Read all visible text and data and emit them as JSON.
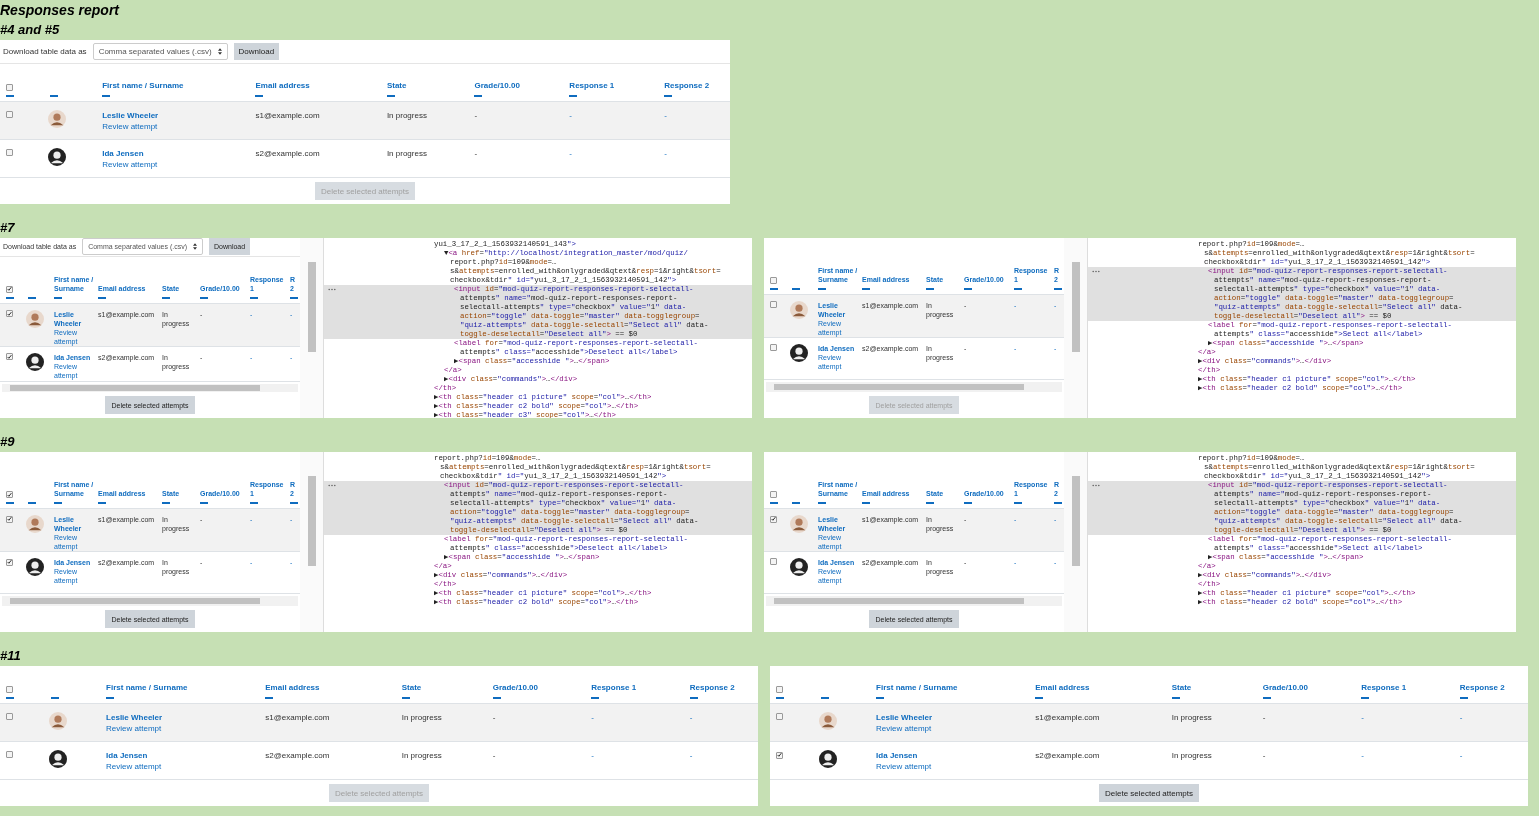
{
  "title": "Responses report",
  "sections": [
    {
      "heading": "#4 and #5",
      "panels": [
        {
          "kind": "report",
          "report": {
            "download": {
              "label": "Download table data as",
              "format": "Comma separated values (.csv)",
              "button": "Download"
            },
            "select_all_checked": false,
            "columns": [
              "First name / Surname",
              "Email address",
              "State",
              "Grade/10.00",
              "Response 1",
              "Response 2"
            ],
            "rows": [
              {
                "checked": false,
                "name": "Leslie Wheeler",
                "link": "Review attempt",
                "email": "s1@example.com",
                "state": "In progress",
                "grade": "-",
                "response_1": "-",
                "response_2": "-"
              },
              {
                "checked": false,
                "name": "Ida Jensen",
                "link": "Review attempt",
                "email": "s2@example.com",
                "state": "In progress",
                "grade": "-",
                "response_1": "-",
                "response_2": "-"
              }
            ],
            "delete_button": {
              "label": "Delete selected attempts",
              "disabled": true
            }
          }
        }
      ]
    },
    {
      "heading": "#7",
      "panels": [
        {
          "kind": "composite",
          "report": {
            "download": {
              "label": "Download table data as",
              "format": "Comma separated values (.csv)",
              "button": "Download"
            },
            "select_all_checked": true,
            "columns": [
              "First name / Surname",
              "Email address",
              "State",
              "Grade/10.00",
              "Response 1",
              "R 2"
            ],
            "rows": [
              {
                "checked": true,
                "name": "Leslie Wheeler",
                "link": "Review attempt",
                "email": "s1@example.com",
                "state": "In progress",
                "grade": "-",
                "response_1": "-",
                "response_2": "-"
              },
              {
                "checked": true,
                "name": "Ida Jensen",
                "link": "Review attempt",
                "email": "s2@example.com",
                "state": "In progress",
                "grade": "-",
                "response_1": "-",
                "response_2": "-"
              }
            ],
            "delete_button": {
              "label": "Delete selected attempts",
              "disabled": false
            }
          },
          "dom": [
            {
              "lines": [
                "yui_3_17_2_1_1563932140591_143\">"
              ],
              "selected": false,
              "close": "</th>",
              "children": [
                {
                  "lines": [
                    "▼<a href=\"http://localhost/integration_master/mod/quiz/",
                    "report.php?id=109&mode=…",
                    "s&attempts=enrolled_with&onlygraded&qtext&resp=1&right&tsort=",
                    "checkbox&tdir\" id=\"yui_3_17_2_1_1563932140591_142\">"
                  ],
                  "selected": false,
                  "close": "</a>",
                  "children": [
                    {
                      "lines": [
                        "<input id=\"mod-quiz-report-responses-report-selectall-",
                        "attempts\" name=\"mod-quiz-report-responses-report-",
                        "selectall-attempts\" type=\"checkbox\" value=\"1\" data-",
                        "action=\"toggle\" data-toggle=\"master\" data-togglegroup=",
                        "\"quiz-attempts\" data-toggle-selectall=\"Select all\" data-",
                        "toggle-deselectall=\"Deselect all\"> == $0"
                      ],
                      "selected": true
                    },
                    {
                      "lines": [
                        "<label for=\"mod-quiz-report-responses-report-selectall-",
                        "attempts\" class=\"accesshide\">Deselect all</label>"
                      ],
                      "selected": false
                    },
                    {
                      "lines": [
                        "▶<span class=\"accesshide \">…</span>"
                      ],
                      "selected": false
                    }
                  ]
                },
                {
                  "lines": [
                    "▶<div class=\"commands\">…</div>"
                  ],
                  "selected": false
                }
              ]
            },
            {
              "lines": [
                "▶<th class=\"header c1 picture\" scope=\"col\">…</th>"
              ],
              "selected": false
            },
            {
              "lines": [
                "▶<th class=\"header c2 bold\" scope=\"col\">…</th>"
              ],
              "selected": false
            },
            {
              "lines": [
                "▶<th class=\"header c3\" scope=\"col\">…</th>"
              ],
              "selected": false
            }
          ]
        },
        {
          "kind": "composite",
          "report": {
            "select_all_checked": false,
            "columns": [
              "First name / Surname",
              "Email address",
              "State",
              "Grade/10.00",
              "Response 1",
              "R 2"
            ],
            "rows": [
              {
                "checked": false,
                "name": "Leslie Wheeler",
                "link": "Review attempt",
                "email": "s1@example.com",
                "state": "In progress",
                "grade": "-",
                "response_1": "-",
                "response_2": "-"
              },
              {
                "checked": false,
                "name": "Ida Jensen",
                "link": "Review attempt",
                "email": "s2@example.com",
                "state": "In progress",
                "grade": "-",
                "response_1": "-",
                "response_2": "-"
              }
            ],
            "delete_button": {
              "label": "Delete selected attempts",
              "disabled": true
            }
          },
          "dom": [
            {
              "lines": [
                "report.php?id=109&mode=…",
                "s&attempts=enrolled_with&onlygraded&qtext&resp=1&right&tsort=",
                "checkbox&tdir\" id=\"yui_3_17_2_1_1563932140591_142\">"
              ],
              "selected": false,
              "close": "</a>",
              "children": [
                {
                  "lines": [
                    "<input id=\"mod-quiz-report-responses-report-selectall-",
                    "attempts\" name=\"mod-quiz-report-responses-report-",
                    "selectall-attempts\" type=\"checkbox\" value=\"1\" data-",
                    "action=\"toggle\" data-toggle=\"master\" data-togglegroup=",
                    "\"quiz-attempts\" data-toggle-selectall=\"Select all\" data-",
                    "toggle-deselectall=\"Deselect all\"> == $0"
                  ],
                  "selected": true
                },
                {
                  "lines": [
                    "<label for=\"mod-quiz-report-responses-report-selectall-",
                    "attempts\" class=\"accesshide\">Select all</label>"
                  ],
                  "selected": false
                },
                {
                  "lines": [
                    "▶<span class=\"accesshide \">…</span>"
                  ],
                  "selected": false
                }
              ]
            },
            {
              "lines": [
                "▶<div class=\"commands\">…</div>"
              ],
              "selected": false
            },
            {
              "lines": [
                "</th>"
              ],
              "selected": false
            },
            {
              "lines": [
                "▶<th class=\"header c1 picture\" scope=\"col\">…</th>"
              ],
              "selected": false
            },
            {
              "lines": [
                "▶<th class=\"header c2 bold\" scope=\"col\">…</th>"
              ],
              "selected": false
            }
          ]
        }
      ]
    },
    {
      "heading": "#9",
      "panels": [
        {
          "kind": "composite",
          "report": {
            "select_all_checked": true,
            "columns": [
              "First name / Surname",
              "Email address",
              "State",
              "Grade/10.00",
              "Response 1",
              "R 2"
            ],
            "rows": [
              {
                "checked": true,
                "name": "Leslie Wheeler",
                "link": "Review attempt",
                "email": "s1@example.com",
                "state": "In progress",
                "grade": "-",
                "response_1": "-",
                "response_2": "-"
              },
              {
                "checked": true,
                "name": "Ida Jensen",
                "link": "Review attempt",
                "email": "s2@example.com",
                "state": "In progress",
                "grade": "-",
                "response_1": "-",
                "response_2": "-"
              }
            ],
            "delete_button": {
              "label": "Delete selected attempts",
              "disabled": false
            }
          },
          "dom": [
            {
              "lines": [
                "report.php?id=109&mode=…",
                "s&attempts=enrolled_with&onlygraded&qtext&resp=1&right&tsort=",
                "checkbox&tdir\" id=\"yui_3_17_2_1_1563932140591_142\">"
              ],
              "selected": false,
              "close": "</a>",
              "children": [
                {
                  "lines": [
                    "<input id=\"mod-quiz-report-responses-report-selectall-",
                    "attempts\" name=\"mod-quiz-report-responses-report-",
                    "selectall-attempts\" type=\"checkbox\" value=\"1\" data-",
                    "action=\"toggle\" data-toggle=\"master\" data-togglegroup=",
                    "\"quiz-attempts\" data-toggle-selectall=\"Select all\" data-",
                    "toggle-deselectall=\"Deselect all\"> == $0"
                  ],
                  "selected": true
                },
                {
                  "lines": [
                    "<label for=\"mod-quiz-report-responses-report-selectall-",
                    "attempts\" class=\"accesshide\">Deselect all</label>"
                  ],
                  "selected": false
                },
                {
                  "lines": [
                    "▶<span class=\"accesshide \">…</span>"
                  ],
                  "selected": false
                }
              ]
            },
            {
              "lines": [
                "▶<div class=\"commands\">…</div>"
              ],
              "selected": false
            },
            {
              "lines": [
                "</th>"
              ],
              "selected": false
            },
            {
              "lines": [
                "▶<th class=\"header c1 picture\" scope=\"col\">…</th>"
              ],
              "selected": false
            },
            {
              "lines": [
                "▶<th class=\"header c2 bold\" scope=\"col\">…</th>"
              ],
              "selected": false
            }
          ]
        },
        {
          "kind": "composite",
          "report": {
            "select_all_checked": false,
            "columns": [
              "First name / Surname",
              "Email address",
              "State",
              "Grade/10.00",
              "Response 1",
              "R 2"
            ],
            "rows": [
              {
                "checked": true,
                "name": "Leslie Wheeler",
                "link": "Review attempt",
                "email": "s1@example.com",
                "state": "In progress",
                "grade": "-",
                "response_1": "-",
                "response_2": "-"
              },
              {
                "checked": false,
                "name": "Ida Jensen",
                "link": "Review attempt",
                "email": "s2@example.com",
                "state": "In progress",
                "grade": "-",
                "response_1": "-",
                "response_2": "-"
              }
            ],
            "delete_button": {
              "label": "Delete selected attempts",
              "disabled": false
            }
          },
          "dom": [
            {
              "lines": [
                "report.php?id=109&mode=…",
                "s&attempts=enrolled_with&onlygraded&qtext&resp=1&right&tsort=",
                "checkbox&tdir\" id=\"yui_3_17_2_1_1563932140591_142\">"
              ],
              "selected": false,
              "close": "</a>",
              "children": [
                {
                  "lines": [
                    "<input id=\"mod-quiz-report-responses-report-selectall-",
                    "attempts\" name=\"mod-quiz-report-responses-report-",
                    "selectall-attempts\" type=\"checkbox\" value=\"1\" data-",
                    "action=\"toggle\" data-toggle=\"master\" data-togglegroup=",
                    "\"quiz-attempts\" data-toggle-selectall=\"Select all\" data-",
                    "toggle-deselectall=\"Deselect all\"> == $0"
                  ],
                  "selected": true
                },
                {
                  "lines": [
                    "<label for=\"mod-quiz-report-responses-report-selectall-",
                    "attempts\" class=\"accesshide\">Select all</label>"
                  ],
                  "selected": false
                },
                {
                  "lines": [
                    "▶<span class=\"accesshide \">…</span>"
                  ],
                  "selected": false
                }
              ]
            },
            {
              "lines": [
                "▶<div class=\"commands\">…</div>"
              ],
              "selected": false
            },
            {
              "lines": [
                "</th>"
              ],
              "selected": false
            },
            {
              "lines": [
                "▶<th class=\"header c1 picture\" scope=\"col\">…</th>"
              ],
              "selected": false
            },
            {
              "lines": [
                "▶<th class=\"header c2 bold\" scope=\"col\">…</th>"
              ],
              "selected": false
            }
          ]
        }
      ]
    },
    {
      "heading": "#11",
      "panels": [
        {
          "kind": "report",
          "report": {
            "select_all_checked": false,
            "columns": [
              "First name / Surname",
              "Email address",
              "State",
              "Grade/10.00",
              "Response 1",
              "Response 2"
            ],
            "rows": [
              {
                "checked": false,
                "name": "Leslie Wheeler",
                "link": "Review attempt",
                "email": "s1@example.com",
                "state": "In progress",
                "grade": "-",
                "response_1": "-",
                "response_2": "-"
              },
              {
                "checked": false,
                "name": "Ida Jensen",
                "link": "Review attempt",
                "email": "s2@example.com",
                "state": "In progress",
                "grade": "-",
                "response_1": "-",
                "response_2": "-"
              }
            ],
            "delete_button": {
              "label": "Delete selected attempts",
              "disabled": true
            }
          }
        },
        {
          "kind": "report",
          "report": {
            "select_all_checked": false,
            "columns": [
              "First name / Surname",
              "Email address",
              "State",
              "Grade/10.00",
              "Response 1",
              "Response 2"
            ],
            "rows": [
              {
                "checked": false,
                "name": "Leslie Wheeler",
                "link": "Review attempt",
                "email": "s1@example.com",
                "state": "In progress",
                "grade": "-",
                "response_1": "-",
                "response_2": "-"
              },
              {
                "checked": true,
                "name": "Ida Jensen",
                "link": "Review attempt",
                "email": "s2@example.com",
                "state": "In progress",
                "grade": "-",
                "response_1": "-",
                "response_2": "-"
              }
            ],
            "delete_button": {
              "label": "Delete selected attempts",
              "disabled": false
            }
          }
        }
      ]
    }
  ]
}
